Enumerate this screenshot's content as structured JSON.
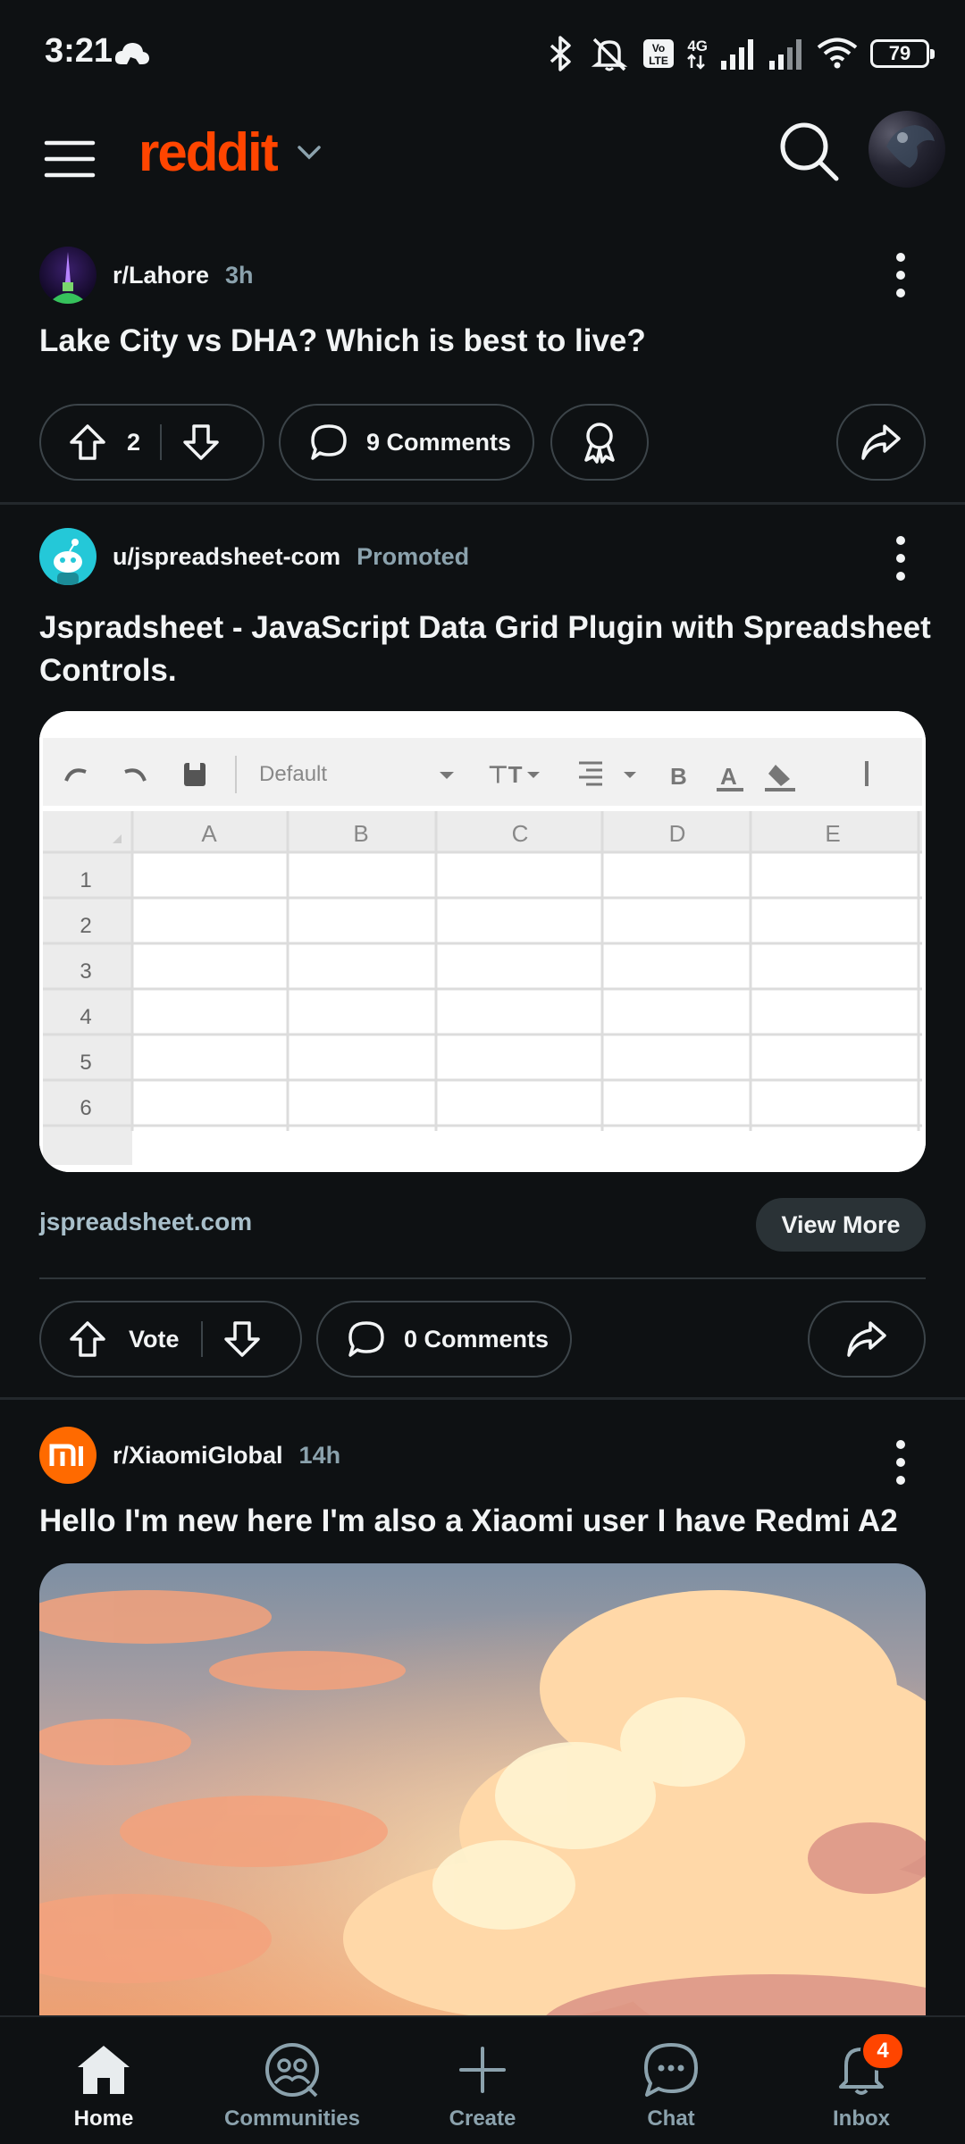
{
  "status_bar": {
    "time": "3:21",
    "network": "4G",
    "battery": "79"
  },
  "header": {
    "logo_text": "reddit",
    "brand_color": "#ff4500"
  },
  "posts": [
    {
      "subreddit": "r/Lahore",
      "time": "3h",
      "title": "Lake City vs DHA? Which is best to live?",
      "votes": "2",
      "comments": "9 Comments"
    },
    {
      "author": "u/jspreadsheet-com",
      "promoted_label": "Promoted",
      "title": "Jspradsheet - JavaScript Data Grid Plugin with Spreadsheet Controls.",
      "image": {
        "font_label": "Default",
        "columns": [
          "A",
          "B",
          "C",
          "D",
          "E"
        ],
        "rows": [
          "1",
          "2",
          "3",
          "4",
          "5",
          "6"
        ]
      },
      "link": "jspreadsheet.com",
      "cta": "View More",
      "votes": "Vote",
      "comments": "0 Comments"
    },
    {
      "subreddit": "r/XiaomiGlobal",
      "time": "14h",
      "title": "Hello I'm new here I'm also a Xiaomi user I have Redmi A2"
    }
  ],
  "bottom_nav": {
    "items": [
      {
        "label": "Home",
        "icon": "home-icon",
        "active": true
      },
      {
        "label": "Communities",
        "icon": "communities-icon"
      },
      {
        "label": "Create",
        "icon": "plus-icon"
      },
      {
        "label": "Chat",
        "icon": "chat-icon"
      },
      {
        "label": "Inbox",
        "icon": "bell-icon",
        "badge": "4"
      }
    ]
  }
}
